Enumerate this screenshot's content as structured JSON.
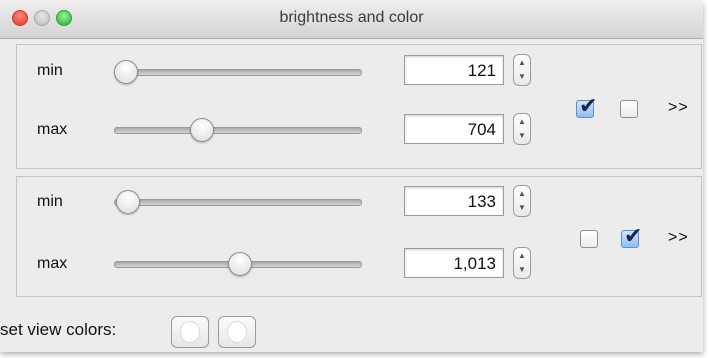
{
  "window": {
    "title": "brightness and color"
  },
  "channels": [
    {
      "min": {
        "label": "min",
        "value": "121"
      },
      "max": {
        "label": "max",
        "value": "704"
      },
      "checkboxes": [
        {
          "checked": true
        },
        {
          "checked": false
        }
      ],
      "more_label": ">>"
    },
    {
      "min": {
        "label": "min",
        "value": "133"
      },
      "max": {
        "label": "max",
        "value": "1,013"
      },
      "checkboxes": [
        {
          "checked": false
        },
        {
          "checked": true
        }
      ],
      "more_label": ">>"
    }
  ],
  "footer": {
    "label": "set view colors:"
  },
  "icons": {
    "check": "✔",
    "step_up": "▲",
    "step_down": "▼"
  }
}
